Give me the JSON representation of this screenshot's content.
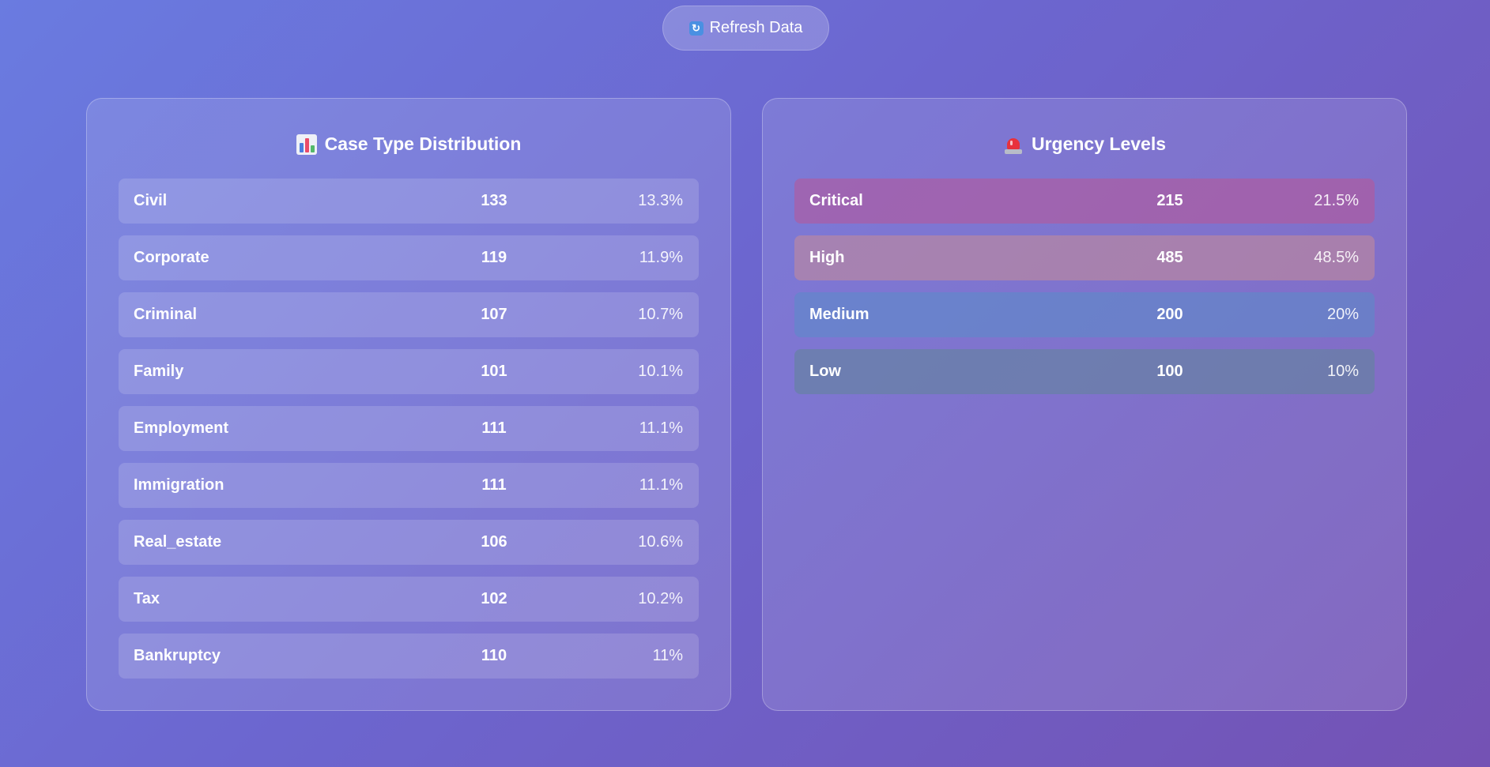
{
  "toolbar": {
    "refresh_label": "Refresh Data",
    "refresh_icon": "refresh-icon"
  },
  "case_types": {
    "title": "Case Type Distribution",
    "icon": "bar-chart-icon",
    "rows": [
      {
        "label": "Civil",
        "count": "133",
        "percent": "13.3%"
      },
      {
        "label": "Corporate",
        "count": "119",
        "percent": "11.9%"
      },
      {
        "label": "Criminal",
        "count": "107",
        "percent": "10.7%"
      },
      {
        "label": "Family",
        "count": "101",
        "percent": "10.1%"
      },
      {
        "label": "Employment",
        "count": "111",
        "percent": "11.1%"
      },
      {
        "label": "Immigration",
        "count": "111",
        "percent": "11.1%"
      },
      {
        "label": "Real_estate",
        "count": "106",
        "percent": "10.6%"
      },
      {
        "label": "Tax",
        "count": "102",
        "percent": "10.2%"
      },
      {
        "label": "Bankruptcy",
        "count": "110",
        "percent": "11%"
      }
    ]
  },
  "urgency": {
    "title": "Urgency Levels",
    "icon": "siren-icon",
    "rows": [
      {
        "label": "Critical",
        "count": "215",
        "percent": "21.5%",
        "color": "#b95596"
      },
      {
        "label": "High",
        "count": "485",
        "percent": "48.5%",
        "color": "#c88c96"
      },
      {
        "label": "Medium",
        "count": "200",
        "percent": "20%",
        "color": "#5a8cc8"
      },
      {
        "label": "Low",
        "count": "100",
        "percent": "10%",
        "color": "#6482a0"
      }
    ]
  }
}
